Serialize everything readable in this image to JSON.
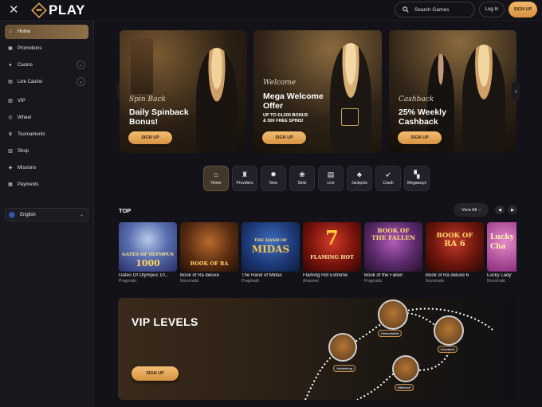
{
  "header": {
    "logo_text": "PLAY",
    "search_placeholder": "Search Games",
    "login_label": "Log In",
    "signup_label": "SIGN UP"
  },
  "sidebar": {
    "items": [
      {
        "label": "Home",
        "icon": "home-icon",
        "active": true
      },
      {
        "label": "Promotions",
        "icon": "gift-icon"
      },
      {
        "label": "Casino",
        "icon": "cards-icon",
        "expandable": true
      },
      {
        "label": "Live Casino",
        "icon": "live-icon",
        "expandable": true
      },
      {
        "label": "VIP",
        "icon": "vip-icon"
      },
      {
        "label": "Wheel",
        "icon": "wheel-icon"
      },
      {
        "label": "Tournaments",
        "icon": "crown-icon"
      },
      {
        "label": "Shop",
        "icon": "shop-icon"
      },
      {
        "label": "Missions",
        "icon": "mission-icon"
      },
      {
        "label": "Payments",
        "icon": "payments-icon"
      }
    ],
    "language": "English"
  },
  "banners": [
    {
      "script": "Spin Back",
      "title_1": "Daily Spinback",
      "title_2": "Bonus!",
      "sub": "",
      "button": "SIGN UP"
    },
    {
      "script": "Welcome",
      "title_1": "Mega Welcome",
      "title_2": "Offer",
      "sub_1": "UP TO €4,500 BONUS",
      "sub_2": "& 500 FREE SPINS!",
      "button": "SIGN UP"
    },
    {
      "script": "Cashback",
      "title_1": "25% Weekly",
      "title_2": "Cashback",
      "sub": "",
      "button": "SIGN UP"
    }
  ],
  "categories": [
    {
      "label": "Home",
      "icon": "home-icon",
      "active": true
    },
    {
      "label": "Providers",
      "icon": "providers-icon"
    },
    {
      "label": "New",
      "icon": "new-icon"
    },
    {
      "label": "Slots",
      "icon": "slots-icon"
    },
    {
      "label": "Live",
      "icon": "live-icon"
    },
    {
      "label": "Jackpots",
      "icon": "jackpots-icon"
    },
    {
      "label": "Crash",
      "icon": "rocket-icon"
    },
    {
      "label": "Megaways",
      "icon": "megaways-icon"
    }
  ],
  "top_section": {
    "title": "TOP",
    "view_all": "View All"
  },
  "games": [
    {
      "name": "Gates Of Olympus 10...",
      "provider": "Pragmatic",
      "art_1": "GATES OF OLYMPUS",
      "art_2": "1000"
    },
    {
      "name": "Book of Ra deluxe",
      "provider": "Novomatic",
      "art_1": "BOOK OF RA",
      "art_2": ""
    },
    {
      "name": "The Hand of Midas",
      "provider": "Pragmatic",
      "art_1": "THE HAND OF",
      "art_2": "MIDAS"
    },
    {
      "name": "Flaming Hot Extreme",
      "provider": "Amusnet",
      "art_1": "7",
      "art_2": "FLAMING HOT"
    },
    {
      "name": "Book of the Fallen",
      "provider": "Pragmatic",
      "art_1": "BOOK OF",
      "art_2": "THE FALLEN"
    },
    {
      "name": "Book of Ra deluxe 6",
      "provider": "Novomatic",
      "art_1": "BOOK OF",
      "art_2": "RA 6"
    },
    {
      "name": "Lucky Lady'",
      "provider": "Novomatic",
      "art_1": "Lucky",
      "art_2": "Cha"
    }
  ],
  "vip": {
    "title": "VIP LEVELS",
    "button": "SIGN UP",
    "levels": [
      "Valdenburg",
      "Himmelsfeld",
      "Kronstein",
      "Silberhof"
    ]
  },
  "colors": {
    "accent": "#e9a852",
    "background": "#131218",
    "sidebar": "#18171d"
  }
}
